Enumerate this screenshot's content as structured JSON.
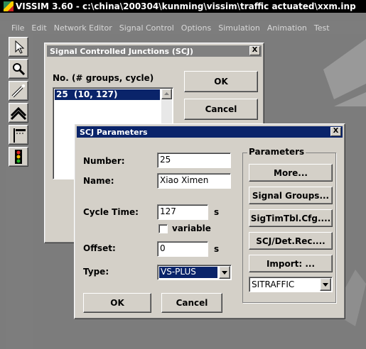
{
  "app": {
    "title": "VISSIM 3.60 - c:\\china\\200304\\kunming\\vissim\\traffic actuated\\xxm.inp",
    "menu": [
      "File",
      "Edit",
      "Network Editor",
      "Signal Control",
      "Options",
      "Simulation",
      "Animation",
      "Test"
    ]
  },
  "toolbar": {
    "tools": [
      "pointer-icon",
      "zoom-icon",
      "wand-icon",
      "roof-icon",
      "signal-head-icon",
      "traffic-light-icon"
    ]
  },
  "scj_list": {
    "title": "Signal Controlled Junctions (SCJ)",
    "list_header": "No. (# groups, cycle)",
    "items": [
      "25  (10, 127)"
    ],
    "ok_label": "OK",
    "cancel_label": "Cancel",
    "close_label": "X"
  },
  "scj_params": {
    "title": "SCJ Parameters",
    "close_label": "X",
    "number_label": "Number:",
    "number_value": "25",
    "name_label": "Name:",
    "name_value": "Xiao Ximen",
    "cycle_label": "Cycle Time:",
    "cycle_value": "127",
    "cycle_unit": "s",
    "variable_label": "variable",
    "offset_label": "Offset:",
    "offset_value": "0",
    "offset_unit": "s",
    "type_label": "Type:",
    "type_value": "VS-PLUS",
    "ok_label": "OK",
    "cancel_label": "Cancel",
    "parameters_group": "Parameters",
    "more_label": "More...",
    "signal_groups_label": "Signal Groups...",
    "sigtim_label": "SigTimTbl.Cfg....",
    "scj_detrec_label": "SCJ/Det.Rec....",
    "import_label": "Import: ...",
    "controller_value": "SITRAFFIC"
  }
}
